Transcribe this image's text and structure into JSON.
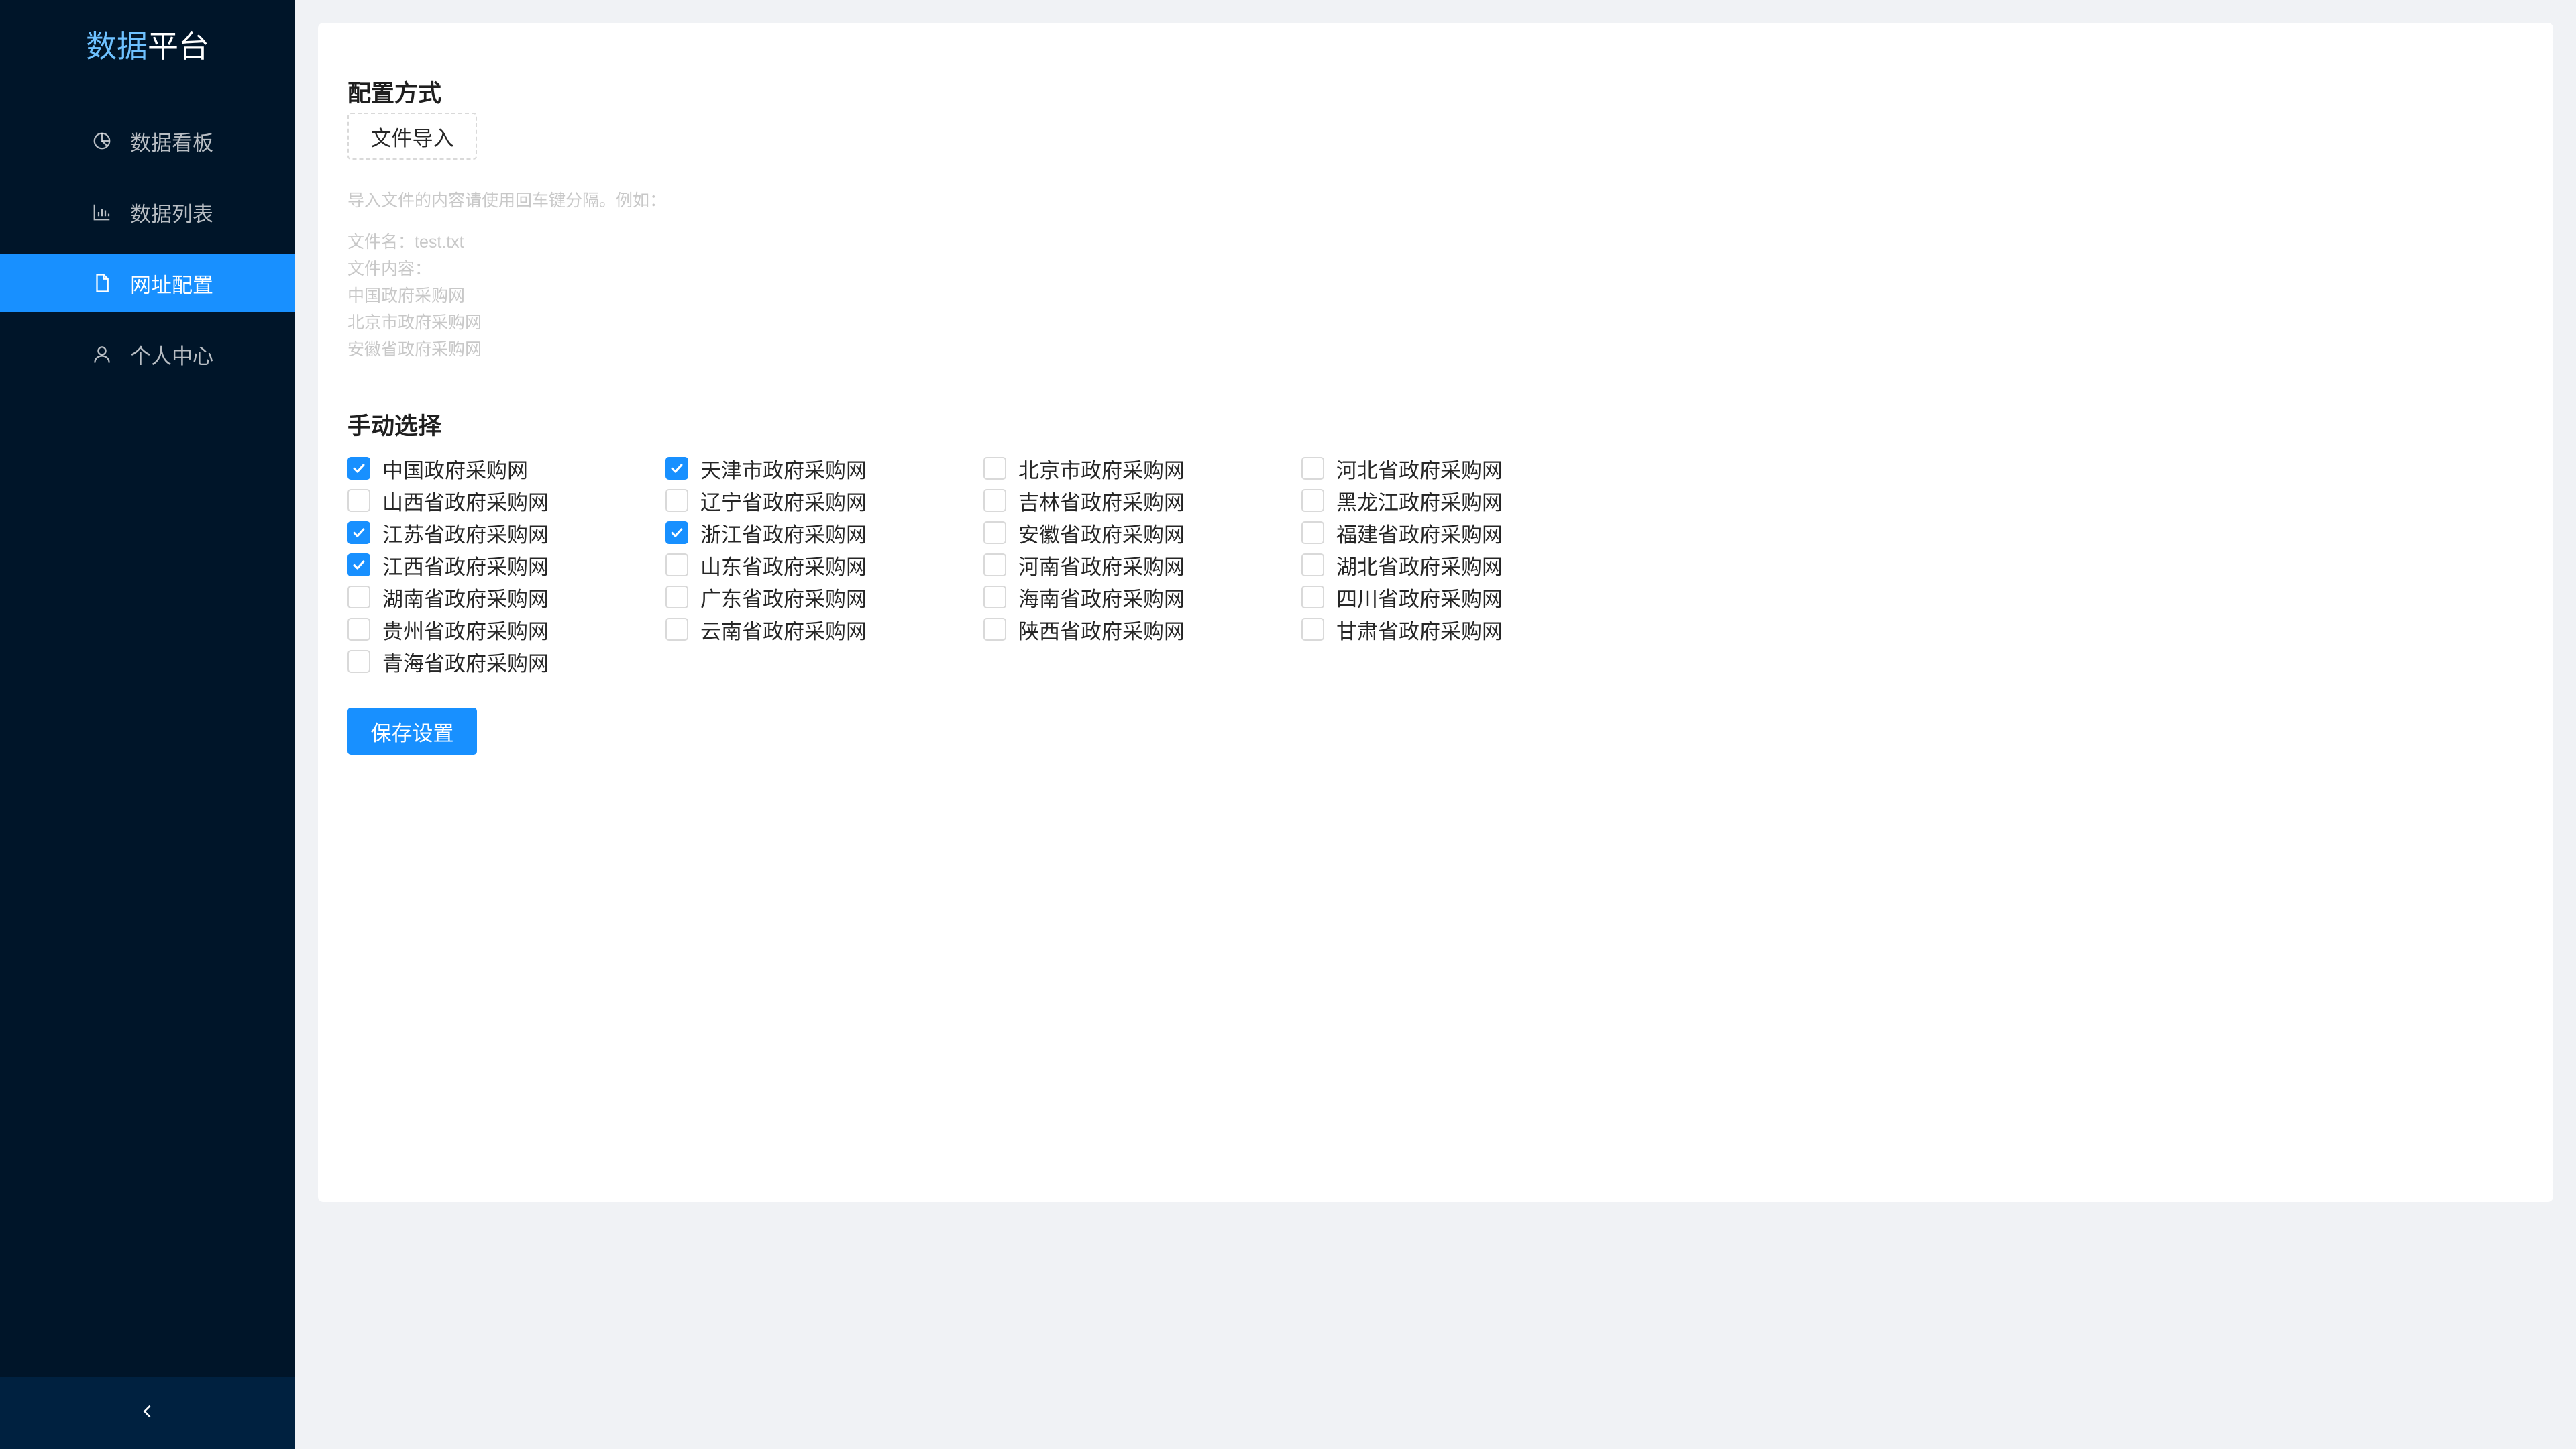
{
  "app": {
    "logo_part1": "数据",
    "logo_part2": "平台"
  },
  "sidebar": {
    "items": [
      {
        "label": "数据看板",
        "icon": "pie-chart-icon",
        "active": false
      },
      {
        "label": "数据列表",
        "icon": "bar-chart-icon",
        "active": false
      },
      {
        "label": "网址配置",
        "icon": "file-icon",
        "active": true
      },
      {
        "label": "个人中心",
        "icon": "user-icon",
        "active": false
      }
    ],
    "collapse_icon": "chevron-left-icon"
  },
  "config": {
    "title": "配置方式",
    "import_button": "文件导入",
    "hint_line1": "导入文件的内容请使用回车键分隔。例如：",
    "hint_example": [
      "文件名：test.txt",
      "文件内容：",
      "中国政府采购网",
      "北京市政府采购网",
      "安徽省政府采购网"
    ]
  },
  "manual": {
    "title": "手动选择",
    "options": [
      {
        "label": "中国政府采购网",
        "checked": true
      },
      {
        "label": "天津市政府采购网",
        "checked": true
      },
      {
        "label": "北京市政府采购网",
        "checked": false
      },
      {
        "label": "河北省政府采购网",
        "checked": false
      },
      {
        "label": "山西省政府采购网",
        "checked": false
      },
      {
        "label": "辽宁省政府采购网",
        "checked": false
      },
      {
        "label": "吉林省政府采购网",
        "checked": false
      },
      {
        "label": "黑龙江政府采购网",
        "checked": false
      },
      {
        "label": "江苏省政府采购网",
        "checked": true
      },
      {
        "label": "浙江省政府采购网",
        "checked": true
      },
      {
        "label": "安徽省政府采购网",
        "checked": false
      },
      {
        "label": "福建省政府采购网",
        "checked": false
      },
      {
        "label": "江西省政府采购网",
        "checked": true
      },
      {
        "label": "山东省政府采购网",
        "checked": false
      },
      {
        "label": "河南省政府采购网",
        "checked": false
      },
      {
        "label": "湖北省政府采购网",
        "checked": false
      },
      {
        "label": "湖南省政府采购网",
        "checked": false
      },
      {
        "label": "广东省政府采购网",
        "checked": false
      },
      {
        "label": "海南省政府采购网",
        "checked": false
      },
      {
        "label": "四川省政府采购网",
        "checked": false
      },
      {
        "label": "贵州省政府采购网",
        "checked": false
      },
      {
        "label": "云南省政府采购网",
        "checked": false
      },
      {
        "label": "陕西省政府采购网",
        "checked": false
      },
      {
        "label": "甘肃省政府采购网",
        "checked": false
      },
      {
        "label": "青海省政府采购网",
        "checked": false
      }
    ],
    "save_button": "保存设置"
  },
  "colors": {
    "sidebar_bg": "#001529",
    "accent": "#1890ff",
    "page_bg": "#f0f2f5"
  }
}
